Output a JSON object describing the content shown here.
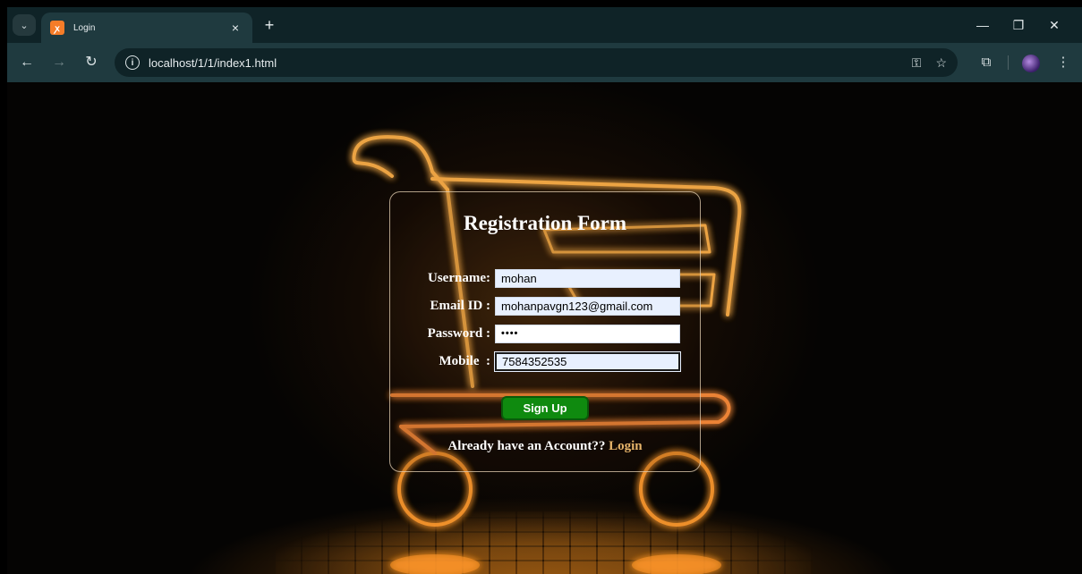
{
  "browser": {
    "tab_title": "Login",
    "tab_close": "×",
    "new_tab": "+",
    "url": "localhost/1/1/index1.html",
    "favicon_icon": "xampp-icon"
  },
  "form": {
    "title": "Registration Form",
    "fields": [
      {
        "label": "Username:",
        "value": "mohan"
      },
      {
        "label": "Email ID :",
        "value": "mohanpavgn123@gmail.com"
      },
      {
        "label": "Password :",
        "value": "••••"
      },
      {
        "label": "Mobile  :",
        "value": "7584352535"
      }
    ],
    "submit_label": "Sign Up",
    "account_prompt": "Already have an Account??",
    "login_link": "Login"
  },
  "colors": {
    "button_green": "#0f8a0f",
    "link_gold": "#e6b46a",
    "neon_orange": "#ff9a2e"
  }
}
